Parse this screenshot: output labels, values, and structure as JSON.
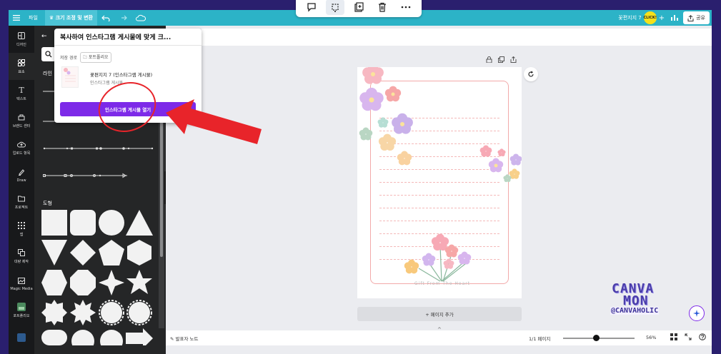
{
  "topbar": {
    "file_label": "파일",
    "resize_label": "♛ 크기 조정 및 변환",
    "project_name": "꽃편지지 7",
    "badge": "CLICK!",
    "share_label": "공유"
  },
  "rail": {
    "items": [
      {
        "label": "디자인",
        "icon": "layout-icon"
      },
      {
        "label": "요소",
        "icon": "elements-icon"
      },
      {
        "label": "텍스트",
        "icon": "text-icon"
      },
      {
        "label": "브랜드 센터",
        "icon": "brand-icon"
      },
      {
        "label": "업로드 항목",
        "icon": "upload-icon"
      },
      {
        "label": "Draw",
        "icon": "draw-icon"
      },
      {
        "label": "프로젝트",
        "icon": "folder-icon"
      },
      {
        "label": "앱",
        "icon": "apps-icon"
      },
      {
        "label": "대량 제작",
        "icon": "bulk-icon"
      },
      {
        "label": "Magic Media",
        "icon": "magic-media-icon"
      },
      {
        "label": "포트폴리오",
        "icon": "portfolio-icon"
      }
    ]
  },
  "panel": {
    "lines_section": "라인",
    "shapes_section": "도형"
  },
  "popup": {
    "title": "복사하여 인스타그램 게시물에 맞게 크...",
    "save_path_label": "저장 경로",
    "folder_label": "포트폴리오",
    "design_name": "꽃편지지 7 (인스타그램 게시물)",
    "design_sub": "인스타그램 게시물",
    "open_button": "인스타그램 게시물 열기"
  },
  "page": {
    "caption": "Gift From The Heart",
    "add_page": "+ 페이지 추가"
  },
  "bottombar": {
    "notes": "발표자 노트",
    "page_count": "1/1 페이지",
    "zoom": "56%",
    "zoom_fraction": 0.42
  },
  "watermark": {
    "line1": "CANVA",
    "line2": "MON",
    "handle": "@CANVAHOLIC"
  },
  "colors": {
    "topbar": "#2cb3c7",
    "accent": "#7d2ae8",
    "annotation": "#e8242a",
    "page_border": "#f2a9a9"
  }
}
